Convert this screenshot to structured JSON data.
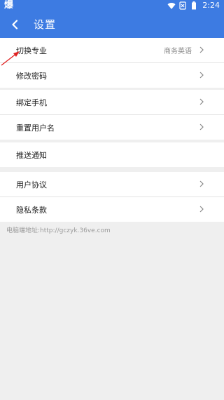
{
  "status_bar": {
    "app_glyph": "爆",
    "time": "2:24",
    "icons": [
      "wifi-icon",
      "sim-disabled-icon",
      "battery-icon"
    ]
  },
  "app_bar": {
    "title": "设置",
    "back_icon": "back-chevron-icon"
  },
  "sections": [
    {
      "rows": [
        {
          "label": "切换专业",
          "value": "商务英语",
          "chevron": true
        },
        {
          "label": "修改密码",
          "value": "",
          "chevron": true
        }
      ]
    },
    {
      "rows": [
        {
          "label": "绑定手机",
          "value": "",
          "chevron": true
        },
        {
          "label": "重置用户名",
          "value": "",
          "chevron": true
        }
      ]
    },
    {
      "rows": [
        {
          "label": "推送通知",
          "value": "",
          "chevron": false
        }
      ]
    },
    {
      "rows": [
        {
          "label": "用户协议",
          "value": "",
          "chevron": true
        },
        {
          "label": "隐私条款",
          "value": "",
          "chevron": true
        }
      ]
    }
  ],
  "footer": {
    "pc_address": "电脑端地址:http://gczyk.36ve.com"
  },
  "colors": {
    "primary": "#3d7be2",
    "background": "#efefef",
    "annotation": "#e02020"
  }
}
